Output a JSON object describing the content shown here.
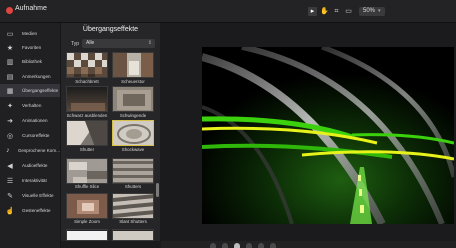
{
  "app": {
    "title": "Aufnahme"
  },
  "toolbar": {
    "tools": [
      {
        "icon": "pointer-icon",
        "glyph": "▸",
        "active": true
      },
      {
        "icon": "hand-icon",
        "glyph": "✋",
        "active": false
      },
      {
        "icon": "crop-icon",
        "glyph": "⌗",
        "active": false
      },
      {
        "icon": "fit-icon",
        "glyph": "▭",
        "active": false
      }
    ],
    "zoom": "50%"
  },
  "sidebar": {
    "items": [
      {
        "label": "Medien",
        "icon": "film-icon",
        "glyph": "▭"
      },
      {
        "label": "Favoriten",
        "icon": "star-icon",
        "glyph": "★"
      },
      {
        "label": "Bibliothek",
        "icon": "library-icon",
        "glyph": "▥"
      },
      {
        "label": "Anmerkungen",
        "icon": "annotation-icon",
        "glyph": "▤"
      },
      {
        "label": "Übergangseffekte",
        "icon": "transition-icon",
        "glyph": "▦",
        "active": true
      },
      {
        "label": "Verhalten",
        "icon": "behavior-icon",
        "glyph": "✦"
      },
      {
        "label": "Animationen",
        "icon": "animation-icon",
        "glyph": "➜"
      },
      {
        "label": "Cursoreffekte",
        "icon": "cursor-icon",
        "glyph": "◎"
      },
      {
        "label": "Gesprochene Kom...",
        "icon": "microphone-icon",
        "glyph": "♪"
      },
      {
        "label": "Audioeffekte",
        "icon": "speaker-icon",
        "glyph": "◀"
      },
      {
        "label": "Interaktivität",
        "icon": "interactivity-icon",
        "glyph": "☰"
      },
      {
        "label": "Visuelle Effekte",
        "icon": "wand-icon",
        "glyph": "✎"
      },
      {
        "label": "Gesteneffekte",
        "icon": "gesture-icon",
        "glyph": "☝"
      }
    ]
  },
  "panel": {
    "title": "Übergangseffekte",
    "type_label": "Typ",
    "type_value": "Alle",
    "items": [
      {
        "caption": "Schachbrett"
      },
      {
        "caption": "Scheuerstor"
      },
      {
        "caption": "Schwarz ausblenden"
      },
      {
        "caption": "Schwingende"
      },
      {
        "caption": "Shutter"
      },
      {
        "caption": "Shockwave",
        "selected": true
      },
      {
        "caption": "Shuffle Slice"
      },
      {
        "caption": "Shutters"
      },
      {
        "caption": "Simple Zoom"
      },
      {
        "caption": "Slant Shutters"
      },
      {
        "caption": ""
      },
      {
        "caption": ""
      }
    ]
  },
  "colors": {
    "accent_selected": "#d4c04a",
    "record_dot": "#e0443e",
    "beam_green": "#3bd10d",
    "beam_yellow": "#e7f21a"
  }
}
